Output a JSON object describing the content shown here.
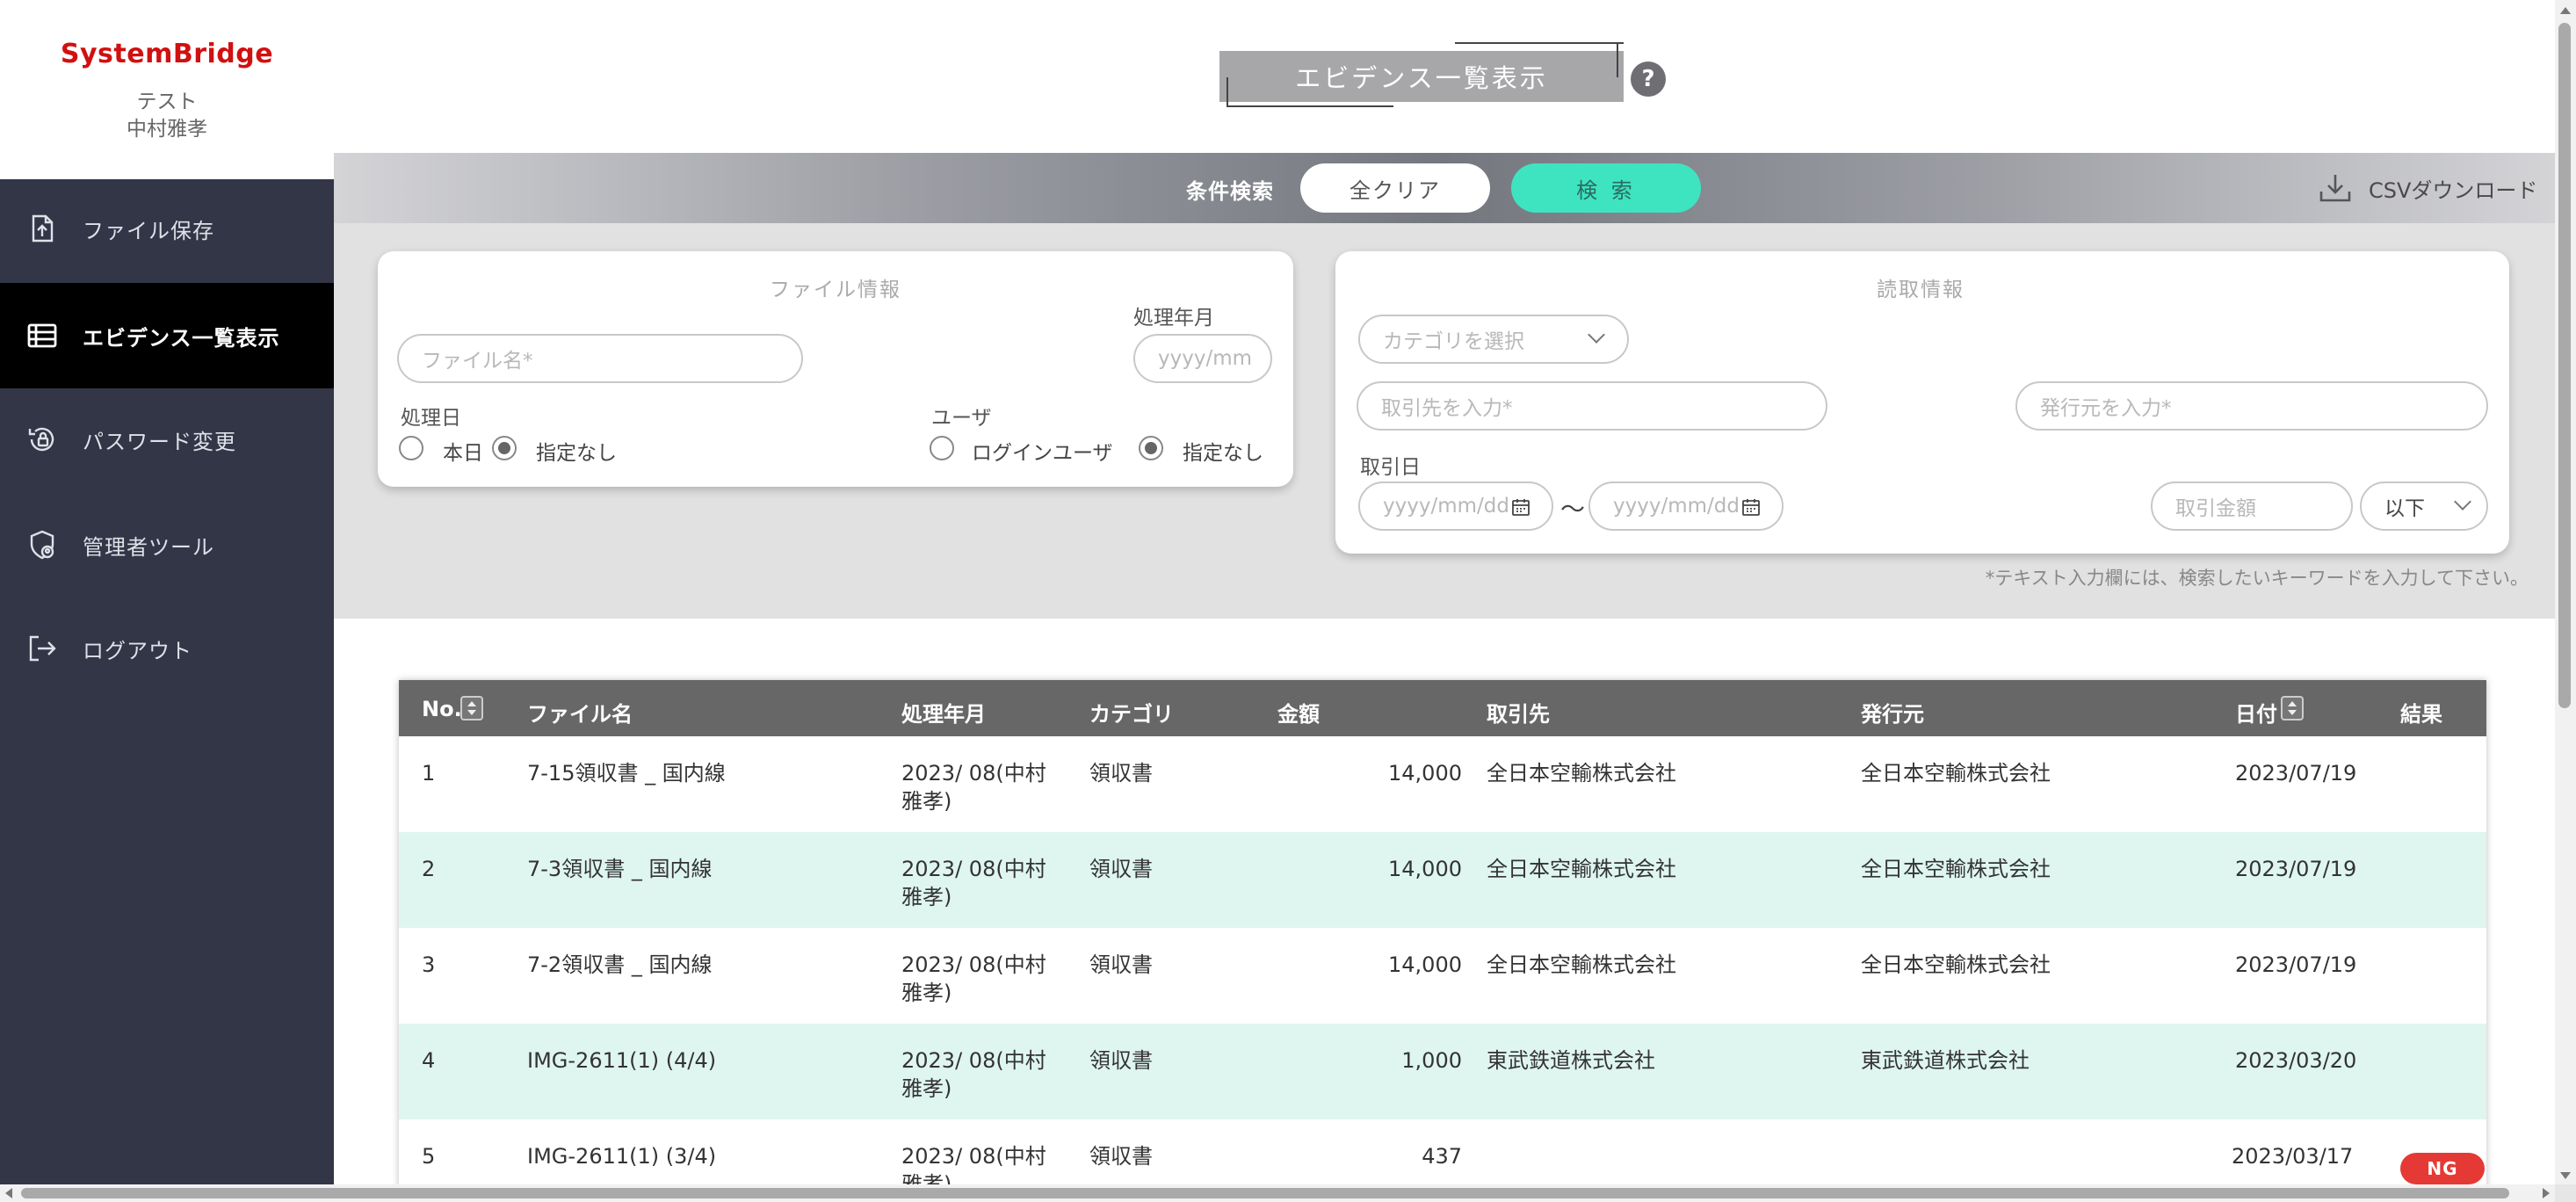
{
  "sidebar": {
    "brand": "SystemBridge",
    "company": "テスト",
    "user": "中村雅孝",
    "items": [
      {
        "label": "ファイル保存",
        "icon": "file-upload-icon"
      },
      {
        "label": "エビデンス一覧表示",
        "icon": "table-list-icon",
        "active": true
      },
      {
        "label": "パスワード変更",
        "icon": "password-reset-icon"
      },
      {
        "label": "管理者ツール",
        "icon": "admin-shield-icon"
      },
      {
        "label": "ログアウト",
        "icon": "logout-icon"
      }
    ]
  },
  "header": {
    "title": "エビデンス一覧表示",
    "help": "?"
  },
  "search_bar": {
    "label": "条件検索",
    "clear": "全クリア",
    "search": "検 索",
    "csv": "CSVダウンロード"
  },
  "file_panel": {
    "title": "ファイル情報",
    "filename_placeholder": "ファイル名*",
    "month_label": "処理年月",
    "month_placeholder": "yyyy/mm",
    "date_label": "処理日",
    "date_opt_today": "本日",
    "date_opt_none": "指定なし",
    "user_label": "ユーザ",
    "user_opt_login": "ログインユーザ",
    "user_opt_none": "指定なし"
  },
  "read_panel": {
    "title": "読取情報",
    "category_placeholder": "カテゴリを選択",
    "partner_placeholder": "取引先を入力*",
    "issuer_placeholder": "発行元を入力*",
    "trade_date_label": "取引日",
    "date_from_placeholder": "yyyy/mm/dd",
    "tilde": "〜",
    "date_to_placeholder": "yyyy/mm/dd",
    "amount_placeholder": "取引金額",
    "compare_value": "以下"
  },
  "note": "*テキスト入力欄には、検索したいキーワードを入力して下さい。",
  "table": {
    "headers": {
      "no": "No.",
      "file": "ファイル名",
      "month": "処理年月",
      "category": "カテゴリ",
      "amount": "金額",
      "partner": "取引先",
      "issuer": "発行元",
      "date": "日付",
      "result": "結果"
    },
    "rows": [
      {
        "no": "1",
        "file": "7-15領収書 _ 国内線",
        "month1": "2023/ 08(中村",
        "month2": "雅孝)",
        "category": "領収書",
        "amount": "14,000",
        "partner": "全日本空輸株式会社",
        "issuer": "全日本空輸株式会社",
        "date": "2023/07/19",
        "result": ""
      },
      {
        "no": "2",
        "file": "7-3領収書 _ 国内線",
        "month1": "2023/ 08(中村",
        "month2": "雅孝)",
        "category": "領収書",
        "amount": "14,000",
        "partner": "全日本空輸株式会社",
        "issuer": "全日本空輸株式会社",
        "date": "2023/07/19",
        "result": ""
      },
      {
        "no": "3",
        "file": "7-2領収書 _ 国内線",
        "month1": "2023/ 08(中村",
        "month2": "雅孝)",
        "category": "領収書",
        "amount": "14,000",
        "partner": "全日本空輸株式会社",
        "issuer": "全日本空輸株式会社",
        "date": "2023/07/19",
        "result": ""
      },
      {
        "no": "4",
        "file": "IMG-2611(1) (4/4)",
        "month1": "2023/ 08(中村",
        "month2": "雅孝)",
        "category": "領収書",
        "amount": "1,000",
        "partner": "東武鉄道株式会社",
        "issuer": "東武鉄道株式会社",
        "date": "2023/03/20",
        "result": ""
      },
      {
        "no": "5",
        "file": "IMG-2611(1) (3/4)",
        "month1": "2023/ 08(中村",
        "month2": "雅孝)",
        "category": "領収書",
        "amount": "437",
        "partner": "",
        "issuer": "",
        "date": "2023/03/17",
        "result": "NG"
      }
    ]
  },
  "colors": {
    "brand_red": "#d11010",
    "sidebar_bg": "#323647",
    "accent_green": "#3ee4c0",
    "row_alt": "#dff6f0",
    "ng_red": "#e53935"
  }
}
